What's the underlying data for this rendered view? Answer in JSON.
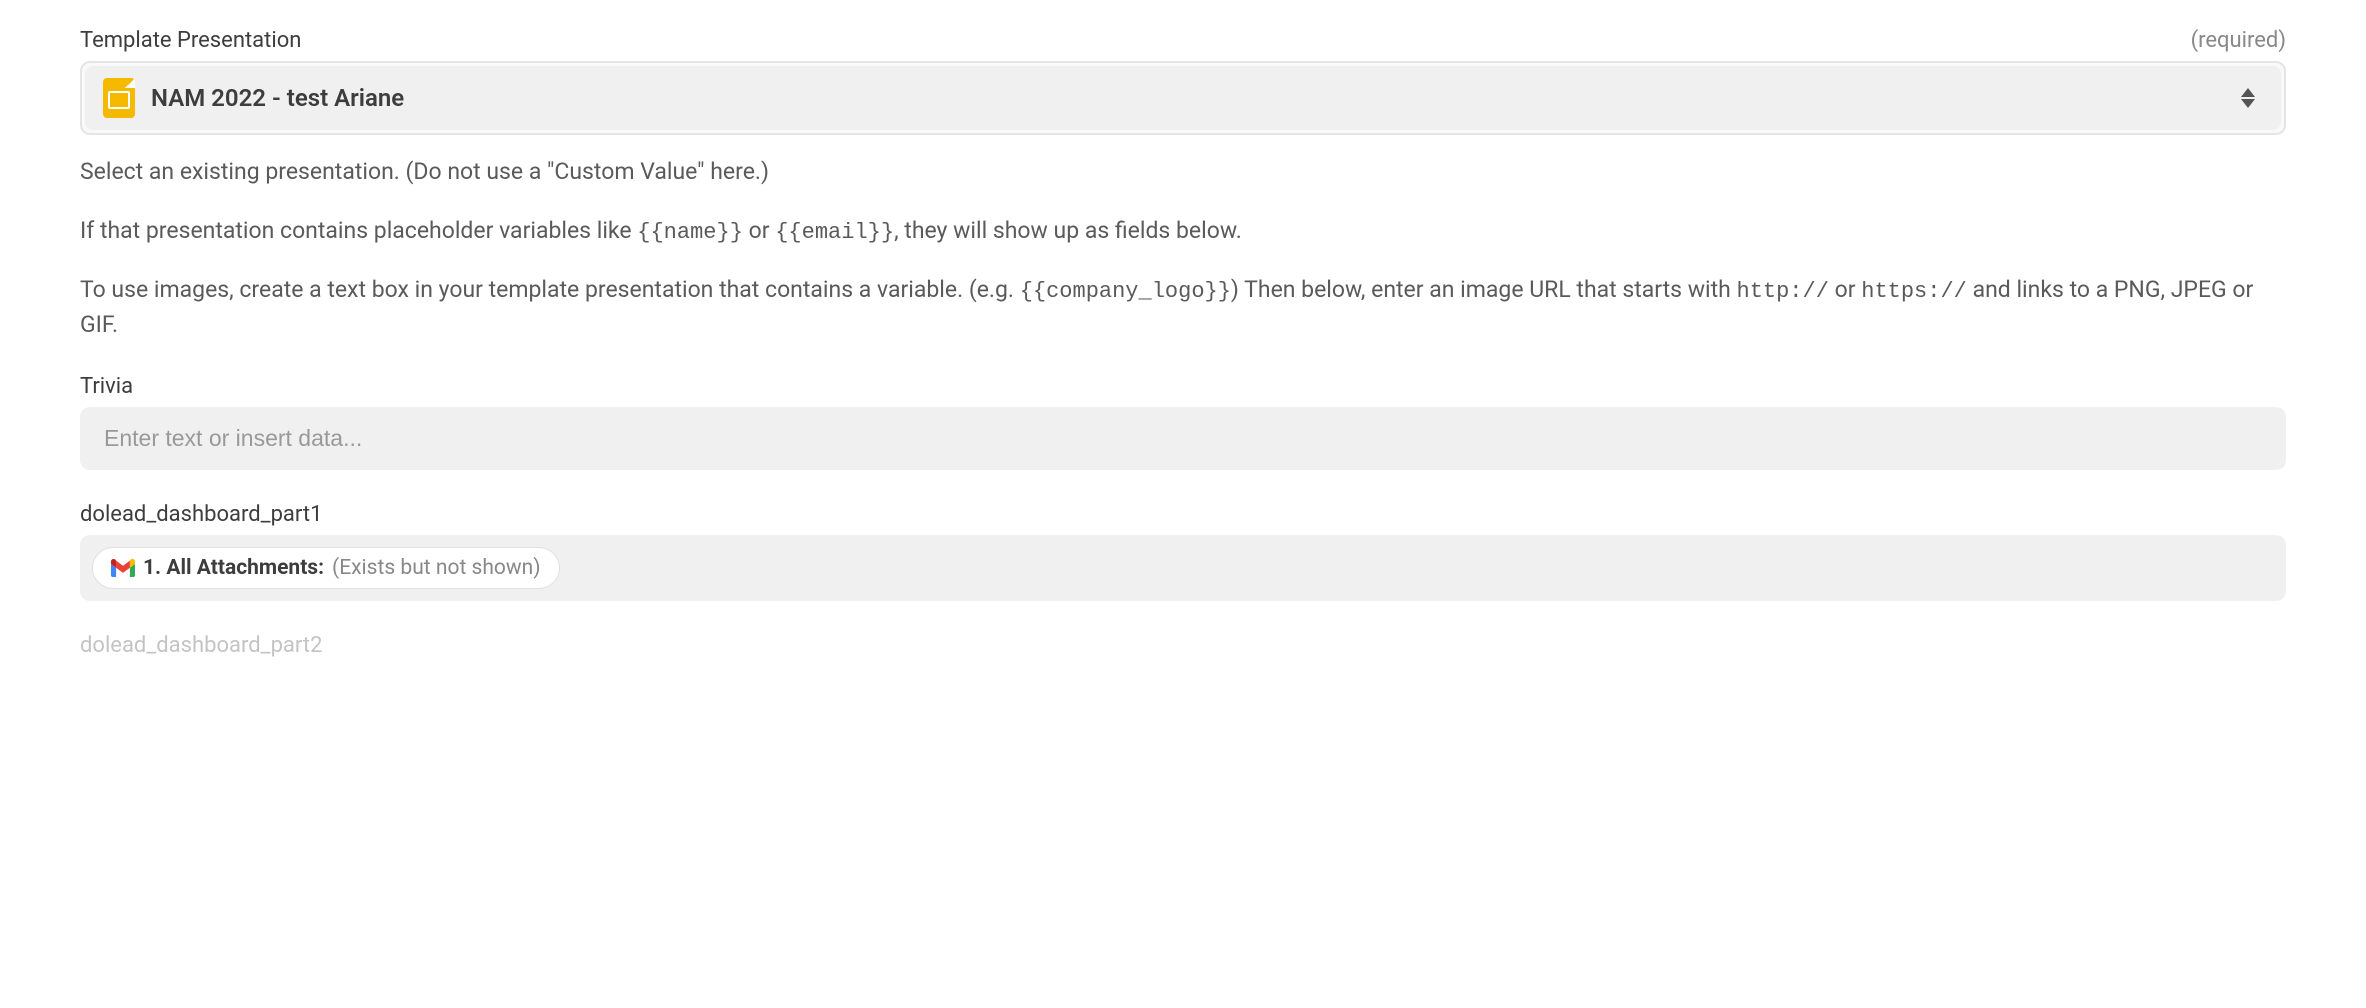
{
  "template_presentation": {
    "label": "Template Presentation",
    "required_text": "(required)",
    "selected_value": "NAM 2022 - test Ariane",
    "help_p1": "Select an existing presentation. (Do not use a \"Custom Value\" here.)",
    "help_p2_pre": "If that presentation contains placeholder variables like ",
    "help_p2_code1": "{{name}}",
    "help_p2_mid": " or ",
    "help_p2_code2": "{{email}}",
    "help_p2_post": ", they will show up as fields below.",
    "help_p3_pre": "To use images, create a text box in your template presentation that contains a variable. (e.g. ",
    "help_p3_code1": "{{company_logo}}",
    "help_p3_mid": ") Then below, enter an image URL that starts with ",
    "help_p3_code2": "http://",
    "help_p3_mid2": " or ",
    "help_p3_code3": "https://",
    "help_p3_post": " and links to a PNG, JPEG or GIF."
  },
  "trivia": {
    "label": "Trivia",
    "placeholder": "Enter text or insert data..."
  },
  "dashboard_part1": {
    "label": "dolead_dashboard_part1",
    "attachment_label": "1. All Attachments: ",
    "attachment_status": "(Exists but not shown)"
  },
  "dashboard_part2": {
    "label": "dolead_dashboard_part2"
  }
}
